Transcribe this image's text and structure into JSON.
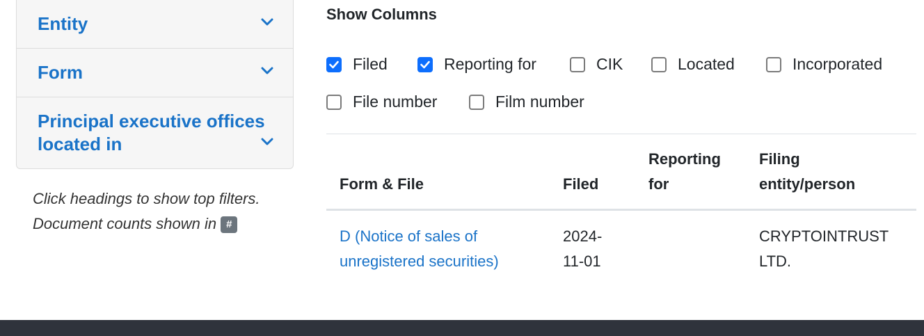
{
  "sidebar": {
    "items": [
      {
        "label": "Entity"
      },
      {
        "label": "Form"
      },
      {
        "label": "Principal executive offices located in"
      }
    ],
    "hint_line1": "Click headings to show top filters.",
    "hint_line2": "Document counts shown in",
    "hint_badge": "#"
  },
  "show_columns": {
    "title": "Show Columns",
    "options": [
      {
        "label": "Filed",
        "checked": true
      },
      {
        "label": "Reporting for",
        "checked": true
      },
      {
        "label": "CIK",
        "checked": false
      },
      {
        "label": "Located",
        "checked": false
      },
      {
        "label": "Incorporated",
        "checked": false
      },
      {
        "label": "File number",
        "checked": false
      },
      {
        "label": "Film number",
        "checked": false
      }
    ]
  },
  "table": {
    "headers": [
      "Form & File",
      "Filed",
      "Reporting for",
      "Filing entity/person"
    ],
    "rows": [
      {
        "form_file": "D (Notice of sales of unregistered securities)",
        "filed": "2024-11-01",
        "reporting_for": "",
        "entity": "CRYPTOINTRUST LTD."
      }
    ]
  },
  "colors": {
    "link": "#1a73c8",
    "checkbox": "#0d6efd",
    "footer": "#2f333c"
  }
}
